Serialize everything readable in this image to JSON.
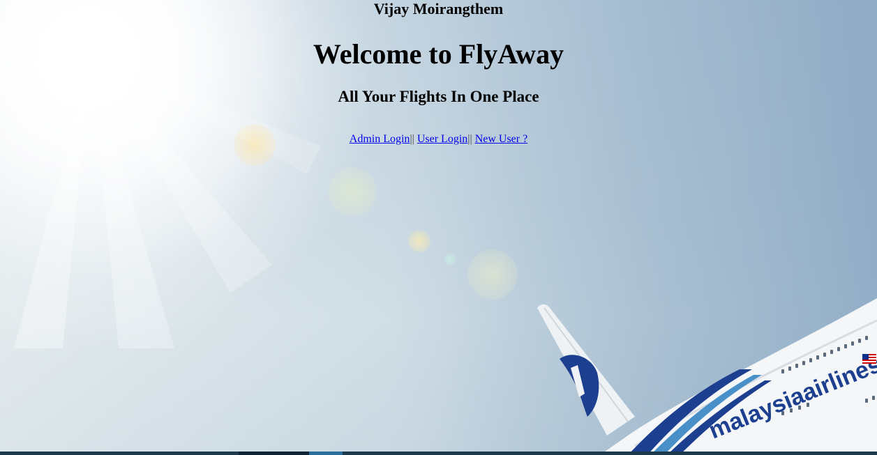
{
  "header": {
    "author": "Vijay Moirangthem",
    "title": "Welcome to FlyAway",
    "subtitle": "All Your Flights In One Place"
  },
  "nav": {
    "admin_login": "Admin Login",
    "user_login": "User Login",
    "new_user": "New User ?",
    "separator": "||"
  },
  "background": {
    "airline_livery_text": "malaysiaairlines",
    "sky_color": "#dfe8ef",
    "link_color": "#0000ee",
    "plane_stripe_color": "#1d3f8f"
  }
}
